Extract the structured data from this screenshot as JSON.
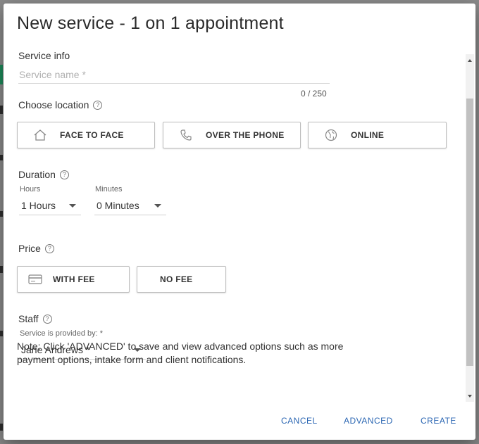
{
  "dialog": {
    "title": "New service - 1 on 1 appointment"
  },
  "service_info": {
    "label": "Service info",
    "name_placeholder": "Service name *",
    "name_value": "",
    "counter": "0 / 250"
  },
  "location": {
    "label": "Choose location",
    "help": "?",
    "options": [
      {
        "label": "FACE TO FACE",
        "icon": "home-icon"
      },
      {
        "label": "OVER THE PHONE",
        "icon": "phone-icon"
      },
      {
        "label": "ONLINE",
        "icon": "globe-icon"
      }
    ]
  },
  "duration": {
    "label": "Duration",
    "help": "?",
    "hours_label": "Hours",
    "hours_value": "1 Hours",
    "minutes_label": "Minutes",
    "minutes_value": "0 Minutes"
  },
  "price": {
    "label": "Price",
    "help": "?",
    "options": [
      {
        "label": "WITH FEE",
        "icon": "credit-card-icon"
      },
      {
        "label": "NO FEE"
      }
    ]
  },
  "staff": {
    "label": "Staff",
    "help": "?",
    "provided_label": "Service is provided by: *",
    "provider_value": "Jane Andrews *"
  },
  "note": "Note: Click 'ADVANCED' to save and view advanced options such as more payment options, intake form and client notifications.",
  "actions": {
    "cancel": "CANCEL",
    "advanced": "ADVANCED",
    "create": "CREATE"
  },
  "colors": {
    "accent": "#2c67b3",
    "overlay": "#8a8a8a"
  }
}
